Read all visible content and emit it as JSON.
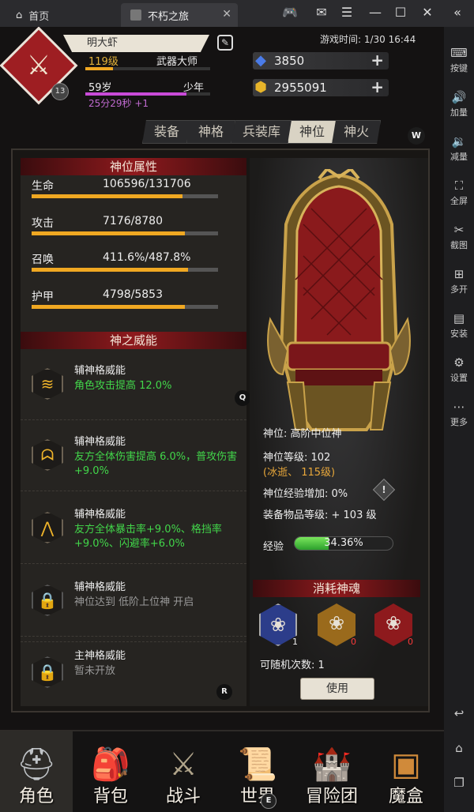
{
  "window": {
    "home_tab": "首页",
    "game_tab": "不朽之旅"
  },
  "sidebar": {
    "items": [
      {
        "label": "按键",
        "icon": "keyboard-icon"
      },
      {
        "label": "加量",
        "icon": "volume-up-icon"
      },
      {
        "label": "减量",
        "icon": "volume-down-icon"
      },
      {
        "label": "全屏",
        "icon": "fullscreen-icon"
      },
      {
        "label": "截图",
        "icon": "scissors-icon"
      },
      {
        "label": "多开",
        "icon": "multi-instance-icon"
      },
      {
        "label": "安装",
        "icon": "apk-install-icon"
      },
      {
        "label": "设置",
        "icon": "settings-gear-icon"
      },
      {
        "label": "更多",
        "icon": "more-icon"
      }
    ]
  },
  "player": {
    "name": "明大虾",
    "avatar_level": "13",
    "level": "119级",
    "title": "武器大师",
    "level_progress": 0.22,
    "age": "59岁",
    "age_stage": "少年",
    "age_progress": 0.81,
    "timer": "25分29秒 +1",
    "game_time": "游戏时间: 1/30 16:44"
  },
  "currency": {
    "diamond": "3850",
    "gold": "2955091"
  },
  "tabs": [
    "装备",
    "神格",
    "兵装库",
    "神位",
    "神火"
  ],
  "active_tab": 3,
  "tab_hotkey": "W",
  "attributes": {
    "header": "神位属性",
    "items": [
      {
        "name": "生命",
        "value": "106596/131706",
        "progress": 0.81
      },
      {
        "name": "攻击",
        "value": "7176/8780",
        "progress": 0.82
      },
      {
        "name": "召唤",
        "value": "411.6%/487.8%",
        "progress": 0.84
      },
      {
        "name": "护甲",
        "value": "4798/5853",
        "progress": 0.82
      }
    ]
  },
  "powers": {
    "header": "神之威能",
    "items": [
      {
        "title": "辅神格威能",
        "desc": "角色攻击提高 12.0%",
        "icon": "triple-flame-icon",
        "locked": false
      },
      {
        "title": "辅神格威能",
        "desc": "友方全体伤害提高 6.0%，普攻伤害+9.0%",
        "icon": "boot-icon",
        "locked": false
      },
      {
        "title": "辅神格威能",
        "desc": "友方全体暴击率+9.0%、格挡率+9.0%、闪避率+6.0%",
        "icon": "wing-icon",
        "locked": false
      },
      {
        "title": "辅神格威能",
        "desc": "神位达到 低阶上位神 开启",
        "icon": "lock-icon",
        "locked": true
      },
      {
        "title": "主神格威能",
        "desc": "暂未开放",
        "icon": "lock-icon",
        "locked": true
      }
    ],
    "hotkey_q": "Q",
    "hotkey_r": "R"
  },
  "god_position": {
    "rank": "神位: 高阶中位神",
    "level": "神位等级: 102",
    "level_extra": "(冰逝、 115级)",
    "exp_bonus": "神位经验增加: 0%",
    "equip_level": "装备物品等级: + 103 级",
    "exp_label": "经验",
    "exp_percent": "34.36%",
    "exp_progress": 0.3436
  },
  "souls": {
    "header": "消耗神魂",
    "items": [
      {
        "count": "1",
        "color": "#2c3d8a",
        "icon": "soul-blue-icon"
      },
      {
        "count": "0",
        "color": "#9a6a1c",
        "icon": "soul-gold-icon"
      },
      {
        "count": "0",
        "color": "#8e1a1d",
        "icon": "soul-red-icon"
      }
    ],
    "random_times": "可随机次数: 1",
    "use_label": "使用"
  },
  "bottom_nav": {
    "items": [
      {
        "label": "角色",
        "icon": "helmet-icon"
      },
      {
        "label": "背包",
        "icon": "backpack-icon"
      },
      {
        "label": "战斗",
        "icon": "sword-shield-icon"
      },
      {
        "label": "世界",
        "icon": "scroll-map-icon"
      },
      {
        "label": "冒险团",
        "icon": "castle-icon"
      },
      {
        "label": "魔盒",
        "icon": "magic-box-icon"
      }
    ],
    "hotkey_e": "E"
  }
}
